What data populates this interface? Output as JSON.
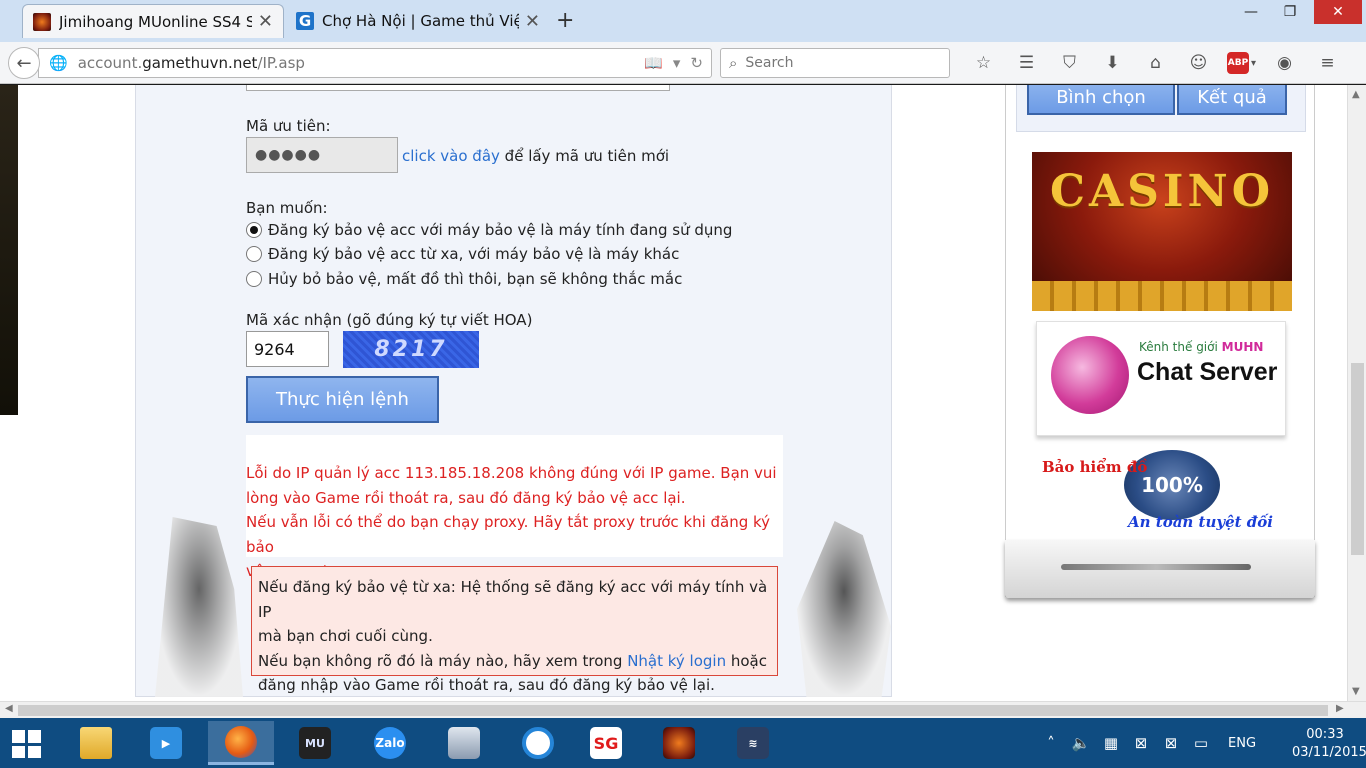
{
  "browser": {
    "tabs": [
      {
        "title": "Jimihoang MUonline SS4 S...",
        "active": true
      },
      {
        "title": "Chợ Hà Nội | Game thủ Việ...",
        "active": false
      }
    ],
    "url_prefix": "account.",
    "url_domain": "gamethuvn.net",
    "url_path": "/IP.asp",
    "search_placeholder": "Search",
    "abp_label": "ABP"
  },
  "form": {
    "priority_label": "Mã ưu tiên:",
    "priority_value": "●●●●●",
    "priority_link": "click vào đây",
    "priority_suffix": "để lấy mã ưu tiên mới",
    "want_label": "Bạn muốn:",
    "options": [
      {
        "label": "Đăng ký bảo vệ acc với máy bảo vệ là máy tính đang sử dụng",
        "checked": true
      },
      {
        "label": "Đăng ký bảo vệ acc từ xa, với máy bảo vệ là máy khác",
        "checked": false
      },
      {
        "label": "Hủy bỏ bảo vệ, mất đồ thì thôi, bạn sẽ không thắc mắc",
        "checked": false
      }
    ],
    "captcha_label": "Mã xác nhận (gõ đúng ký tự viết HOA)",
    "captcha_value": "9264",
    "captcha_image_text": "8217",
    "submit_label": "Thực hiện lệnh"
  },
  "error": {
    "line1": "Lỗi do IP quản lý acc 113.185.18.208 không đúng với IP game. Bạn vui",
    "line2": "lòng vào Game rồi thoát ra, sau đó đăng ký bảo vệ acc lại.",
    "line3": "Nếu vẫn lỗi có thể do bạn chạy proxy. Hãy tắt proxy trước khi đăng ký bảo",
    "line4": "vệ account"
  },
  "info": {
    "line1": "Nếu đăng ký bảo vệ từ xa: Hệ thống sẽ đăng ký acc với máy tính và IP",
    "line2": "mà bạn chơi cuối cùng.",
    "line3_prefix": "Nếu bạn không rõ đó là máy nào, hãy xem trong ",
    "line3_link": "Nhật ký login",
    "line3_suffix": " hoặc",
    "line4": "đăng nhập vào Game rồi thoát ra, sau đó đăng ký bảo vệ lại."
  },
  "sidebar": {
    "vote_button": "Bình chọn",
    "result_button": "Kết quả",
    "casino_text": "CASINO",
    "chat_kenh": "Kênh thế giới",
    "chat_muhn": "MUHN",
    "chat_server": "Chat Server",
    "insurance_top": "Bảo hiểm đồ",
    "insurance_pct": "100%",
    "insurance_bottom": "An toàn tuyệt đối"
  },
  "taskbar": {
    "apps": [
      "file-explorer",
      "media-player",
      "firefox",
      "mu-online",
      "zalo",
      "resource-monitor",
      "eye-app",
      "sg-app",
      "mu-online-2",
      "wifi-app"
    ],
    "active_app": "firefox",
    "zalo_label": "Zalo",
    "mu_label": "MU",
    "sg_label": "SG",
    "lang": "ENG",
    "time": "00:33",
    "date": "03/11/2015"
  },
  "colors": {
    "accent_button": "#6c9be6",
    "error_text": "#dd2222",
    "link": "#2a6fcf",
    "taskbar": "#0f4c81"
  }
}
